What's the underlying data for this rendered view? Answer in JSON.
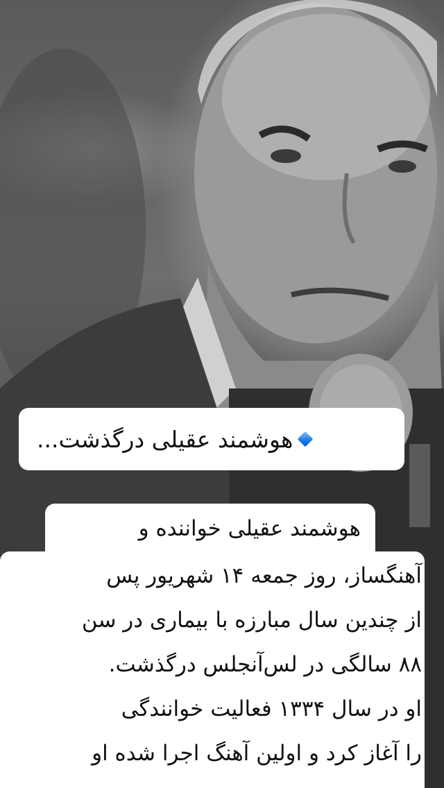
{
  "photo": {
    "description_icon": "portrait-photo"
  },
  "caption": {
    "icon": "small-blue-diamond-icon",
    "title": "هوشمند عقیلی درگذشت..."
  },
  "body": {
    "lines": [
      "هوشمند عقیلی خواننده و",
      "آهنگساز،  روز جمعه ۱۴ شهریور پس",
      "از چندین سال مبارزه با بیماری در سن",
      "۸۸ سالگی در لس‌آنجلس درگذشت.",
      "او در سال ۱۳۳۴ فعالیت خوانندگی",
      "را آغاز کرد و اولین آهنگ اجرا شده او"
    ]
  },
  "colors": {
    "bubble": "#ffffff",
    "text": "#111111",
    "accent": "#1f7ee8"
  }
}
